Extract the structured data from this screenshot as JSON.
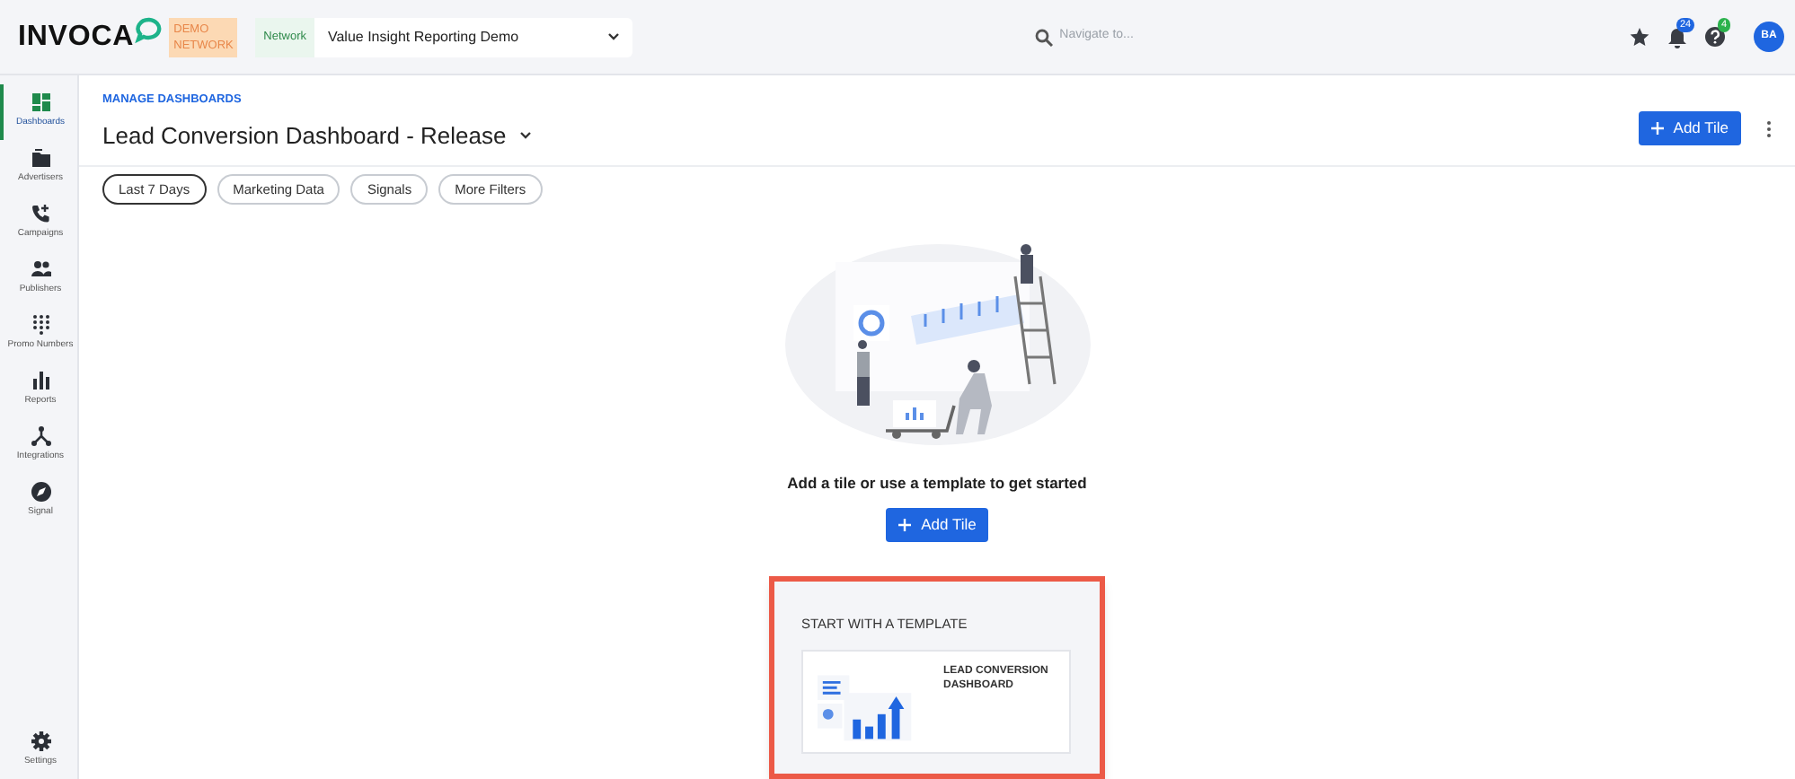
{
  "header": {
    "logo": "INVOCA",
    "badge": "DEMO NETWORK",
    "network_label": "Network",
    "network_value": "Value Insight Reporting Demo",
    "search": {
      "placeholder": "Navigate to..."
    },
    "notifications": "24",
    "help": "4",
    "avatar": "BA"
  },
  "sidebar": {
    "items": [
      {
        "label": "Dashboards",
        "selected": true
      },
      {
        "label": "Advertisers",
        "selected": false
      },
      {
        "label": "Campaigns",
        "selected": false
      },
      {
        "label": "Publishers",
        "selected": false
      },
      {
        "label": "Promo Numbers",
        "selected": false
      },
      {
        "label": "Reports",
        "selected": false
      },
      {
        "label": "Integrations",
        "selected": false
      },
      {
        "label": "Signal",
        "selected": false
      }
    ],
    "footer": {
      "label": "Settings",
      "selected": false
    }
  },
  "breadcrumb": "MANAGE DASHBOARDS",
  "title": "Lead Conversion Dashboard - Release",
  "add_tile": "Add Tile",
  "filters": [
    {
      "label": "Last 7 Days",
      "selected": true
    },
    {
      "label": "Marketing Data",
      "selected": false
    },
    {
      "label": "Signals",
      "selected": false
    },
    {
      "label": "More Filters",
      "selected": false
    }
  ],
  "empty_state": {
    "message": "Add a tile or use a template to get started",
    "button": "Add Tile"
  },
  "templates": {
    "title": "START WITH A TEMPLATE",
    "highlighted": true,
    "items": [
      {
        "name": "LEAD CONVERSION DASHBOARD"
      }
    ]
  }
}
